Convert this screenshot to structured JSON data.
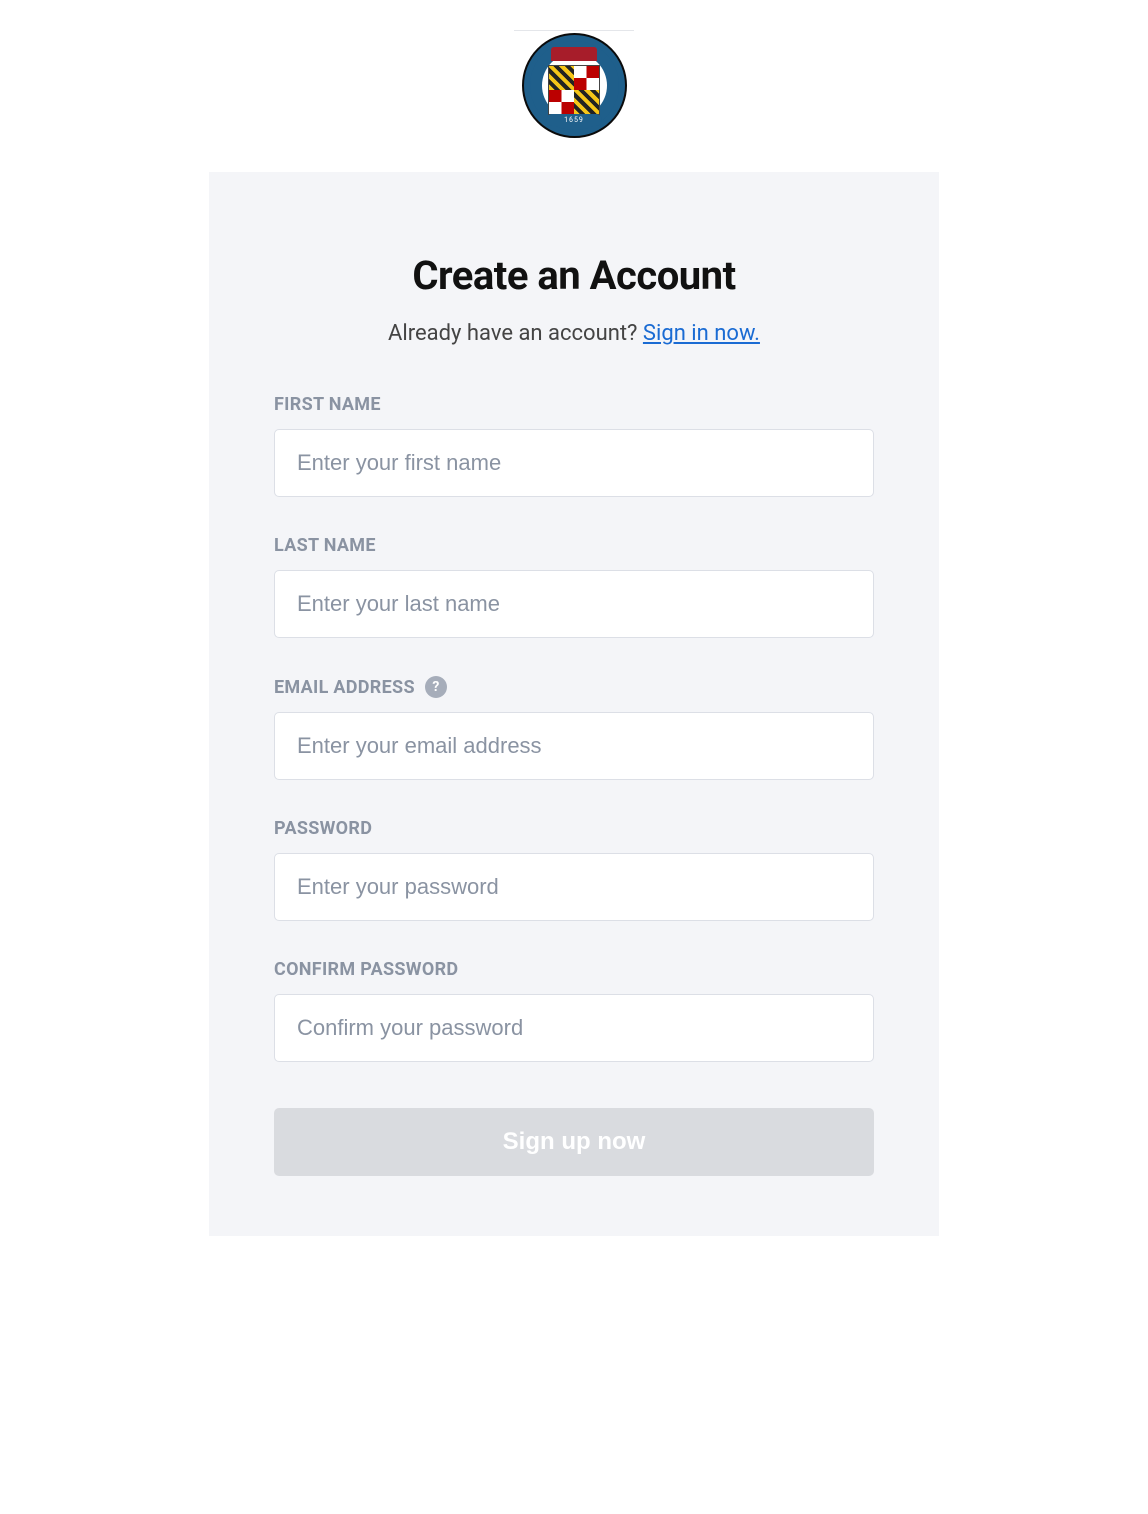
{
  "header": {
    "seal_banner": "1659"
  },
  "card": {
    "title": "Create an Account",
    "subtitle_prefix": "Already have an account? ",
    "signin_link": "Sign in now."
  },
  "form": {
    "first_name": {
      "label": "FIRST NAME",
      "placeholder": "Enter your first name",
      "value": ""
    },
    "last_name": {
      "label": "LAST NAME",
      "placeholder": "Enter your last name",
      "value": ""
    },
    "email": {
      "label": "EMAIL ADDRESS",
      "placeholder": "Enter your email address",
      "value": ""
    },
    "password": {
      "label": "PASSWORD",
      "placeholder": "Enter your password",
      "value": ""
    },
    "confirm_password": {
      "label": "CONFIRM PASSWORD",
      "placeholder": "Confirm your password",
      "value": ""
    },
    "submit_label": "Sign up now"
  },
  "icons": {
    "help_glyph": "?"
  }
}
